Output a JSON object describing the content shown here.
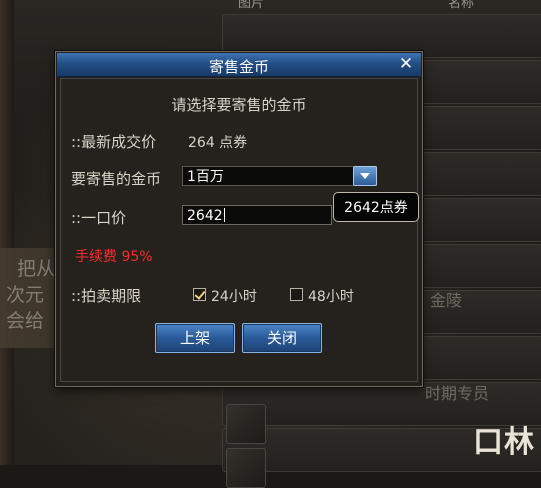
{
  "background": {
    "col_headers": [
      "图片",
      "名称"
    ],
    "item_text_lines": [
      "把从",
      "次元",
      "会给"
    ],
    "lower_text": "时期专员",
    "side_text": "金陵"
  },
  "dialog": {
    "title": "寄售金币",
    "close_glyph": "✕",
    "prompt": "请选择要寄售的金币",
    "latest_price_label": "::最新成交价",
    "latest_price_value": "264 点券",
    "amount_label": "要寄售的金币",
    "amount_selected": "1百万",
    "price_label": "::一口价",
    "price_value": "2642",
    "price_tooltip": "2642点券",
    "fee_text": "手续费 95%",
    "period_label": "::拍卖期限",
    "period_options": [
      {
        "label": "24小时",
        "checked": true
      },
      {
        "label": "48小时",
        "checked": false
      }
    ],
    "list_button": "上架",
    "close_button": "关闭"
  },
  "watermark": "口林",
  "colors": {
    "title_bar": "#234f86",
    "button": "#2a5a98",
    "fee_text": "#ff2a2a",
    "panel": "#25221e"
  }
}
